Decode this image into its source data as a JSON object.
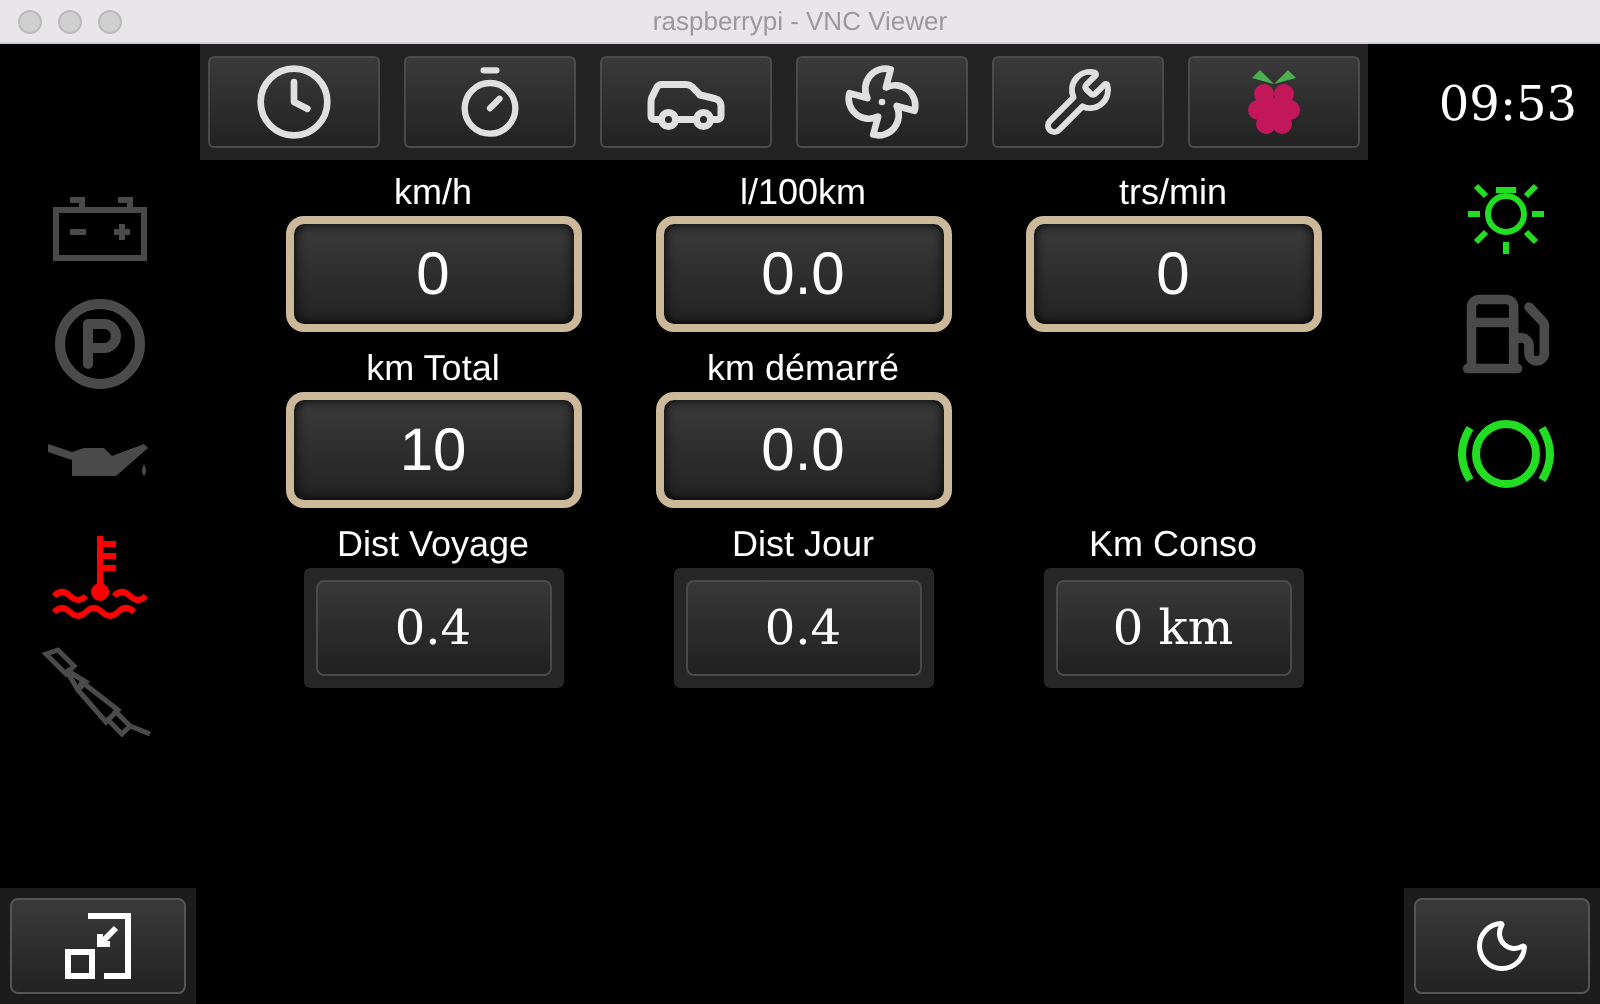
{
  "window": {
    "title": "raspberrypi - VNC Viewer"
  },
  "toolbar": [
    {
      "kind": "clock"
    },
    {
      "kind": "stopwatch"
    },
    {
      "kind": "car"
    },
    {
      "kind": "fan"
    },
    {
      "kind": "tools"
    },
    {
      "kind": "raspberry"
    }
  ],
  "clock": "09:53",
  "left_lights": [
    {
      "kind": "battery",
      "lit": false
    },
    {
      "kind": "parking",
      "lit": false
    },
    {
      "kind": "oil",
      "lit": false
    },
    {
      "kind": "temperature",
      "lit": true,
      "color": "#ff0000"
    },
    {
      "kind": "sparkplug",
      "lit": false
    }
  ],
  "right_lights": [
    {
      "kind": "headlight",
      "lit": true,
      "color": "#22dd22"
    },
    {
      "kind": "fuel",
      "lit": false
    },
    {
      "kind": "brake",
      "lit": true,
      "color": "#22dd22"
    }
  ],
  "gauges": [
    {
      "kind": "framed",
      "label": "km/h",
      "value": "0"
    },
    {
      "kind": "framed",
      "label": "l/100km",
      "value": "0.0"
    },
    {
      "kind": "framed",
      "label": "trs/min",
      "value": "0"
    },
    {
      "kind": "framed",
      "label": "km Total",
      "value": "10"
    },
    {
      "kind": "framed",
      "label": "km démarré",
      "value": "0.0"
    },
    {
      "kind": "empty"
    },
    {
      "kind": "plain",
      "label": "Dist Voyage",
      "value": "0.4"
    },
    {
      "kind": "plain",
      "label": "Dist Jour",
      "value": "0.4"
    },
    {
      "kind": "plain",
      "label": "Km Conso",
      "value": "0 km"
    }
  ],
  "bottom_buttons": [
    {
      "kind": "window-resize"
    },
    {
      "kind": "night-mode"
    }
  ]
}
